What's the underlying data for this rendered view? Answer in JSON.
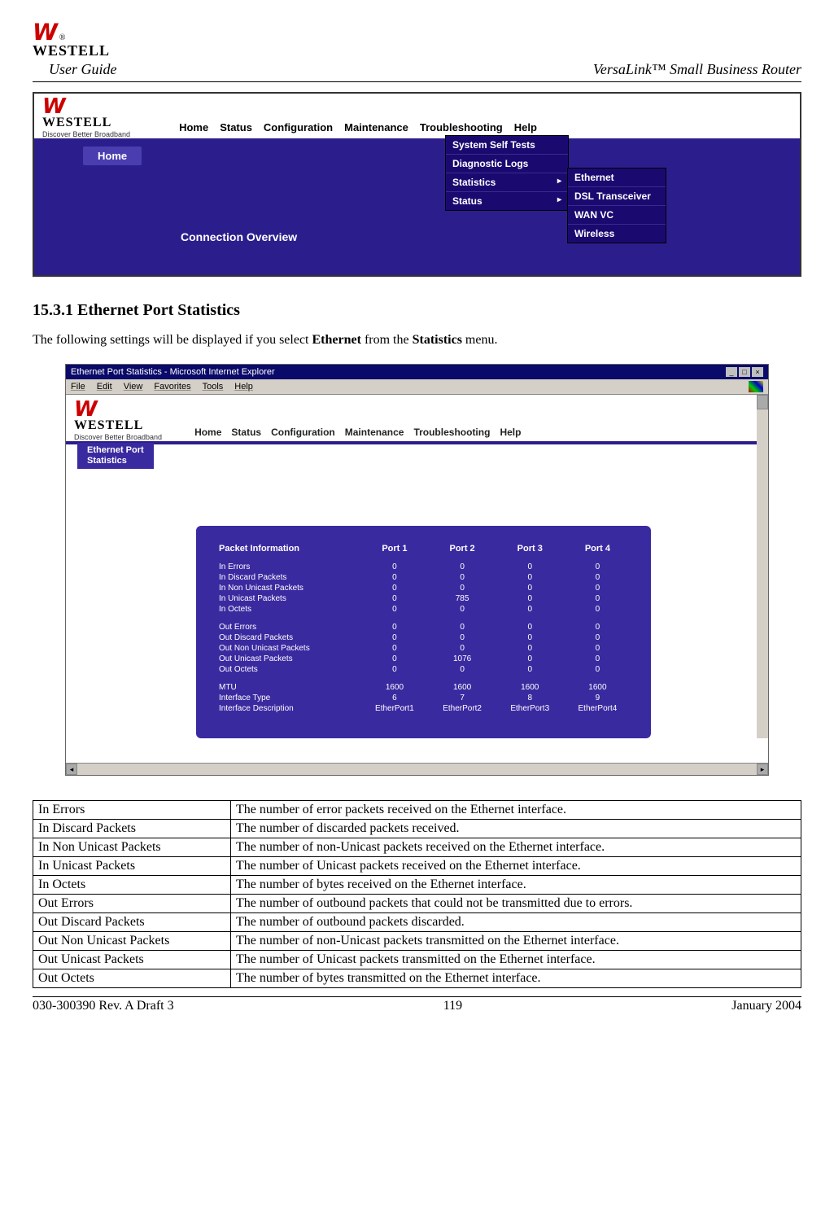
{
  "header": {
    "brand": "WESTELL",
    "user_guide": "User Guide",
    "product": "VersaLink™  Small Business Router"
  },
  "screenshot1": {
    "tagline": "Discover  Better  Broadband",
    "menubar": [
      "Home",
      "Status",
      "Configuration",
      "Maintenance",
      "Troubleshooting",
      "Help"
    ],
    "home_tab": "Home",
    "dropdown": [
      "System Self Tests",
      "Diagnostic Logs",
      "Statistics",
      "Status"
    ],
    "submenu": [
      "Ethernet",
      "DSL Transceiver",
      "WAN VC",
      "Wireless"
    ],
    "connection": "Connection Overview"
  },
  "section": {
    "heading": "15.3.1  Ethernet Port Statistics",
    "text_before": "The following settings will be displayed if you select ",
    "bold1": "Ethernet",
    "text_mid": " from the ",
    "bold2": "Statistics",
    "text_after": " menu."
  },
  "screenshot2": {
    "titlebar": "Ethernet Port Statistics - Microsoft Internet Explorer",
    "ie_menu": [
      "File",
      "Edit",
      "View",
      "Favorites",
      "Tools",
      "Help"
    ],
    "tagline": "Discover  Better  Broadband",
    "menubar": [
      "Home",
      "Status",
      "Configuration",
      "Maintenance",
      "Troubleshooting",
      "Help"
    ],
    "tag_line1": "Ethernet Port",
    "tag_line2": "Statistics",
    "panel": {
      "header": [
        "Packet Information",
        "Port 1",
        "Port 2",
        "Port 3",
        "Port 4"
      ],
      "rows_in": [
        {
          "label": "In Errors",
          "v": [
            "0",
            "0",
            "0",
            "0"
          ]
        },
        {
          "label": "In Discard Packets",
          "v": [
            "0",
            "0",
            "0",
            "0"
          ]
        },
        {
          "label": "In Non Unicast Packets",
          "v": [
            "0",
            "0",
            "0",
            "0"
          ]
        },
        {
          "label": "In Unicast Packets",
          "v": [
            "0",
            "785",
            "0",
            "0"
          ]
        },
        {
          "label": "In Octets",
          "v": [
            "0",
            "0",
            "0",
            "0"
          ]
        }
      ],
      "rows_out": [
        {
          "label": "Out Errors",
          "v": [
            "0",
            "0",
            "0",
            "0"
          ]
        },
        {
          "label": "Out Discard Packets",
          "v": [
            "0",
            "0",
            "0",
            "0"
          ]
        },
        {
          "label": "Out Non Unicast Packets",
          "v": [
            "0",
            "0",
            "0",
            "0"
          ]
        },
        {
          "label": "Out Unicast Packets",
          "v": [
            "0",
            "1076",
            "0",
            "0"
          ]
        },
        {
          "label": "Out Octets",
          "v": [
            "0",
            "0",
            "0",
            "0"
          ]
        }
      ],
      "rows_meta": [
        {
          "label": "MTU",
          "v": [
            "1600",
            "1600",
            "1600",
            "1600"
          ]
        },
        {
          "label": "Interface Type",
          "v": [
            "6",
            "7",
            "8",
            "9"
          ]
        },
        {
          "label": "Interface Description",
          "v": [
            "EtherPort1",
            "EtherPort2",
            "EtherPort3",
            "EtherPort4"
          ]
        }
      ]
    }
  },
  "definitions": [
    {
      "term": "In Errors",
      "desc": "The number of error packets received on the Ethernet interface."
    },
    {
      "term": "In Discard Packets",
      "desc": "The number of discarded packets received."
    },
    {
      "term": "In Non Unicast Packets",
      "desc": "The number of non-Unicast packets received on the Ethernet interface."
    },
    {
      "term": "In Unicast Packets",
      "desc": "The number of Unicast packets received on the Ethernet interface."
    },
    {
      "term": "In Octets",
      "desc": "The number of bytes received on the Ethernet interface."
    },
    {
      "term": "Out Errors",
      "desc": "The number of outbound packets that could not be transmitted due to errors."
    },
    {
      "term": "Out Discard Packets",
      "desc": "The number of outbound packets discarded."
    },
    {
      "term": "Out Non Unicast Packets",
      "desc": "The number of non-Unicast packets transmitted on the Ethernet interface."
    },
    {
      "term": "Out Unicast Packets",
      "desc": "The number of Unicast packets transmitted on the Ethernet interface."
    },
    {
      "term": "Out Octets",
      "desc": "The number of bytes transmitted on the Ethernet interface."
    }
  ],
  "footer": {
    "left": "030-300390 Rev. A Draft 3",
    "center": "119",
    "right": "January 2004"
  }
}
